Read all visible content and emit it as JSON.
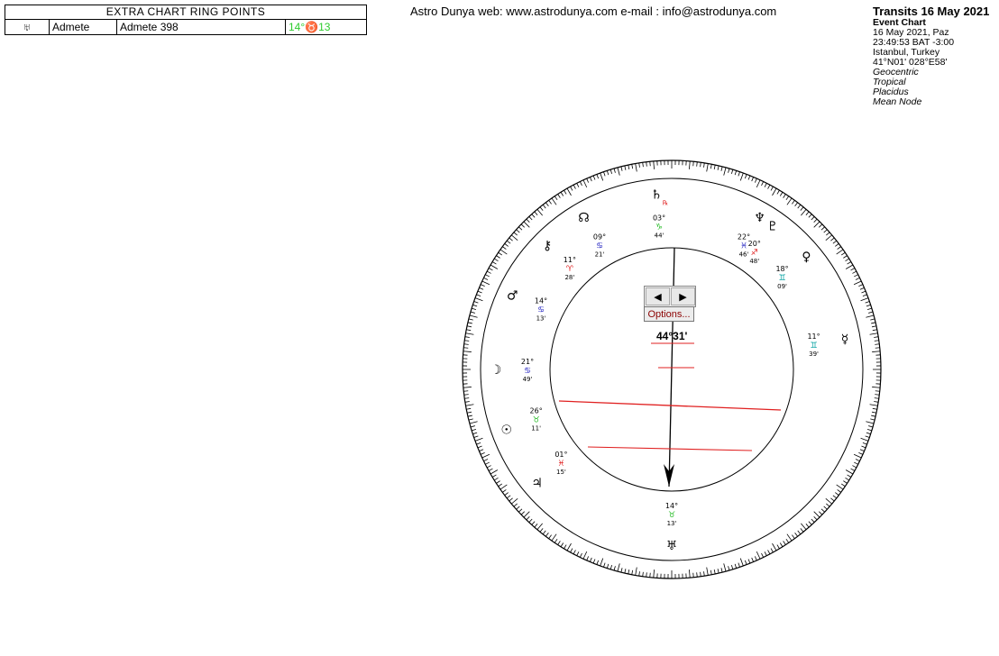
{
  "ring_table": {
    "title": "EXTRA CHART RING POINTS",
    "row": {
      "symbol": "♅",
      "name": "Admete",
      "full_name": "Admete 398",
      "position": "14°♉13"
    }
  },
  "site_info": "Astro Dunya web: www.astrodunya.com e-mail : info@astrodunya.com",
  "chart_info": {
    "title": "Transits 16 May 2021",
    "subtitle": "Event Chart",
    "date": "16 May 2021, Paz",
    "time": "23:49:53  BAT -3:00",
    "place": "Istanbul, Turkey",
    "coords": "41°N01' 028°E58'",
    "settings": [
      "Geocentric",
      "Tropical",
      "Placidus",
      "Mean Node"
    ]
  },
  "colors": {
    "red": "#e02020",
    "green": "#22bb22",
    "blue": "#2020c0",
    "teal": "#00a0a0",
    "purple": "#8a2aa0",
    "olive": "#9a9a00"
  },
  "wheel": {
    "nav_prev_icon": "◀",
    "nav_next_icon": "▶",
    "options_label": "Options...",
    "aspect_value": "44°31'",
    "ticks": {
      "label_step": 5,
      "tick_step": 1
    },
    "points": [
      {
        "glyph": "♄",
        "deg": "03°",
        "sign": "♑",
        "min": "44'",
        "r": "℞"
      },
      {
        "glyph": "☊",
        "deg": "09°",
        "sign": "♋",
        "min": "21'"
      },
      {
        "glyph": "⚷",
        "deg": "11°",
        "sign": "♈",
        "min": "28'"
      },
      {
        "glyph": "♆",
        "deg": "22°",
        "sign": "♓",
        "min": "46'"
      },
      {
        "glyph": "♇",
        "deg": "20°",
        "sign": "♐",
        "min": "48'"
      },
      {
        "glyph": "♀",
        "deg": "18°",
        "sign": "♊",
        "min": "09'"
      },
      {
        "glyph": "☽",
        "deg": "21°",
        "sign": "♋",
        "min": "49'"
      },
      {
        "glyph": "♂",
        "deg": "14°",
        "sign": "♋",
        "min": "13'"
      },
      {
        "glyph": "☉",
        "deg": "26°",
        "sign": "♉",
        "min": "11'"
      },
      {
        "glyph": "☿",
        "deg": "11°",
        "sign": "♊",
        "min": "39'"
      },
      {
        "glyph": "♃",
        "deg": "01°",
        "sign": "♓",
        "min": "15'"
      },
      {
        "glyph": "♅",
        "deg": "14°",
        "sign": "♉",
        "min": "13'"
      }
    ]
  }
}
